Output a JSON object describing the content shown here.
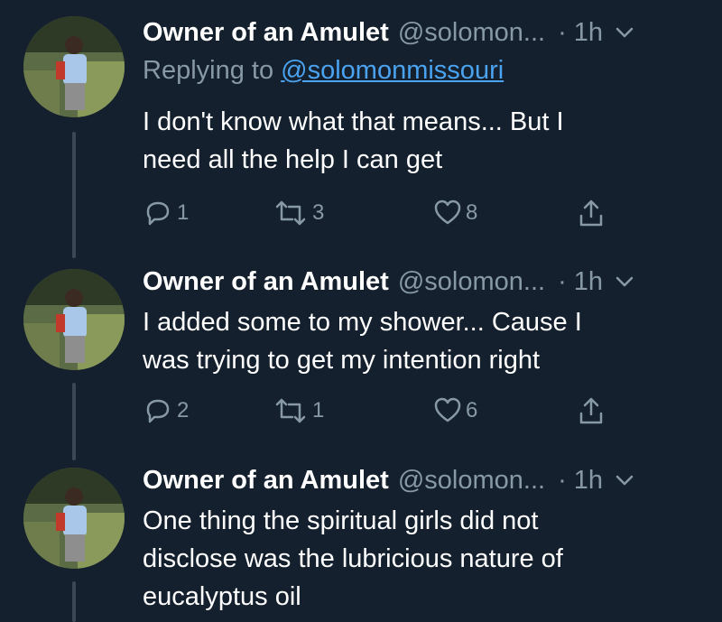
{
  "tweets": [
    {
      "name": "Owner of an Amulet",
      "handle": "@solomon...",
      "time": "· 1h",
      "reply_prefix": "Replying to",
      "reply_handle": "@solomonmissouri",
      "text_lines": [
        "I don't know what that means... But I",
        "need all the help I can get"
      ],
      "replies": "1",
      "retweets": "3",
      "likes": "8"
    },
    {
      "name": "Owner of an Amulet",
      "handle": "@solomon...",
      "time": "· 1h",
      "text_lines": [
        "I added some to my shower... Cause I",
        "was trying to get my intention right"
      ],
      "replies": "2",
      "retweets": "1",
      "likes": "6"
    },
    {
      "name": "Owner of an Amulet",
      "handle": "@solomon...",
      "time": "· 1h",
      "text_lines": [
        "One thing the spiritual girls did not",
        "disclose was the lubricious nature of",
        "eucalyptus oil"
      ]
    }
  ],
  "icons": {
    "reply": "reply-icon",
    "retweet": "retweet-icon",
    "like": "heart-icon",
    "share": "share-icon",
    "more": "chevron-down-icon"
  },
  "colors": {
    "background": "#14202d",
    "secondary_text": "#8899a6",
    "link": "#4aa3f0"
  }
}
